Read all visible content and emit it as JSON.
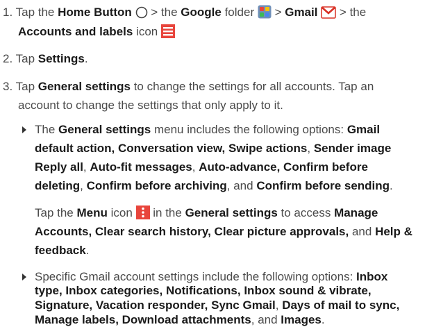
{
  "step1": {
    "num": "1.",
    "t1": "Tap the ",
    "home": "Home Button",
    "t2": " > the ",
    "google": "Google",
    "t3": " folder ",
    "t4": " > ",
    "gmail": "Gmail",
    "t5": " > the",
    "accounts": "Accounts and labels",
    "t6": " icon "
  },
  "step2": {
    "num": "2.",
    "t1": "Tap ",
    "settings": "Settings",
    "t2": "."
  },
  "step3": {
    "num": "3.",
    "t1": "Tap ",
    "general": "General settings",
    "t2": " to change the settings for all accounts. Tap an",
    "l2": "account to change the settings that only apply to it."
  },
  "bullet1": {
    "a1": "The ",
    "a2": "General settings",
    "a3": " menu includes the following options: ",
    "a4": "Gmail",
    "b1": "default action, Conversation view, Swipe actions",
    "b2": ", ",
    "b3": "Sender image",
    "c1": "Reply all",
    "c2": ", ",
    "c3": "Auto-fit messages",
    "c4": ", ",
    "c5": "Auto-advance, Confirm before",
    "d1": "deleting",
    "d2": ", ",
    "d3": "Confirm before archiving",
    "d4": ", and ",
    "d5": "Confirm before sending",
    "d6": "."
  },
  "menu_para": {
    "a1": "Tap the ",
    "a2": "Menu",
    "a3": " icon ",
    "a4": " in the ",
    "a5": "General settings",
    "a6": " to access ",
    "a7": "Manage",
    "b1": "Accounts, Clear search history, Clear picture approvals,",
    "b2": " and ",
    "b3": "Help &",
    "c1": "feedback",
    "c2": "."
  },
  "bullet2": {
    "a1": "Specific Gmail account settings include the following options: ",
    "a2": "Inbox",
    "b1": "type, Inbox categories, Notifications, Inbox sound & vibrate,",
    "c1": "Signature, Vacation responder, Sync Gmail",
    "c2": ", ",
    "c3": "Days of mail to sync,",
    "d1": "Manage labels, Download attachments",
    "d2": ", and ",
    "d3": "Images",
    "d4": "."
  },
  "icons": {
    "home": "home-circle-icon",
    "google_folder": "google-folder-icon",
    "gmail": "gmail-icon",
    "accounts_labels": "accounts-and-labels-icon",
    "menu": "menu-icon"
  },
  "colors": {
    "accent_red": "#e8453c",
    "gmail_red": "#d93025"
  }
}
